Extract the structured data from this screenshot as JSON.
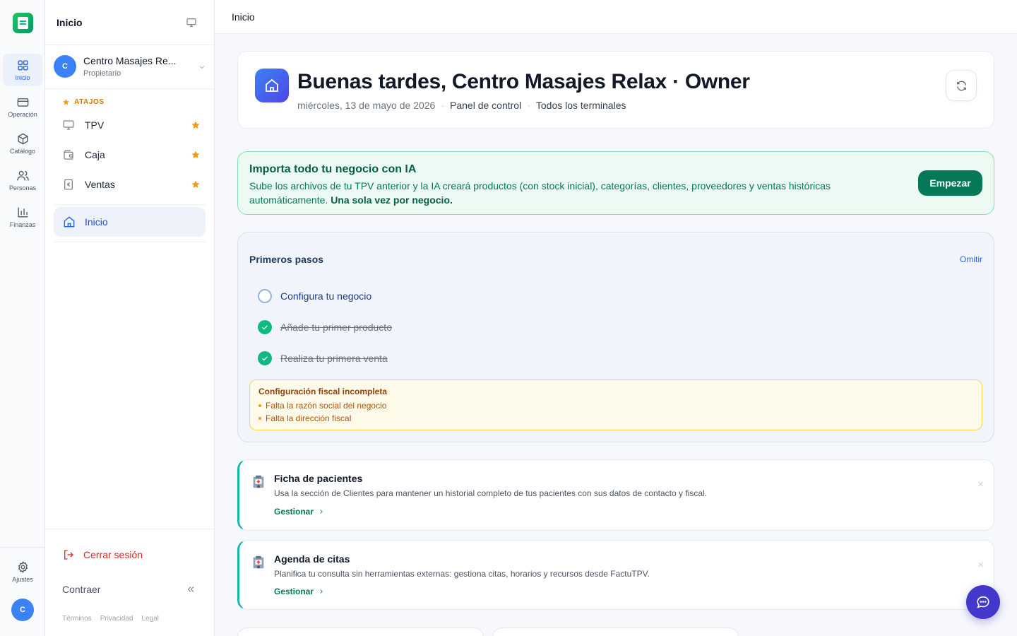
{
  "rail": {
    "items": [
      {
        "label": "Inicio",
        "icon": "grid-icon",
        "active": true
      },
      {
        "label": "Operación",
        "icon": "credit-card-icon"
      },
      {
        "label": "Catálogo",
        "icon": "box-icon"
      },
      {
        "label": "Personas",
        "icon": "users-icon"
      },
      {
        "label": "Finanzas",
        "icon": "bar-chart-icon"
      }
    ],
    "settings_label": "Ajustes",
    "avatar_initial": "C"
  },
  "sidebar": {
    "title": "Inicio",
    "business": {
      "name": "Centro Masajes Re...",
      "role": "Propietario",
      "initial": "C"
    },
    "shortcuts_label": "ATAJOS",
    "shortcuts": [
      {
        "label": "TPV",
        "icon": "monitor-icon"
      },
      {
        "label": "Caja",
        "icon": "wallet-icon"
      },
      {
        "label": "Ventas",
        "icon": "receipt-icon"
      }
    ],
    "active_nav": "Inicio",
    "logout_label": "Cerrar sesión",
    "collapse_label": "Contraer",
    "legal_links": [
      "Términos",
      "Privacidad",
      "Legal"
    ]
  },
  "topbar": {
    "breadcrumb": "Inicio"
  },
  "hero": {
    "greeting": "Buenas tardes, Centro Masajes Relax · Owner",
    "date": "miércoles, 13 de mayo de 2026",
    "panel": "Panel de control",
    "terminals": "Todos los terminales"
  },
  "ia_banner": {
    "title": "Importa todo tu negocio con IA",
    "text": "Sube los archivos de tu TPV anterior y la IA creará productos (con stock inicial), categorías, clientes, proveedores y ventas históricas automáticamente.",
    "bold": "Una sola vez por negocio.",
    "button": "Empezar"
  },
  "onboarding": {
    "title": "Primeros pasos",
    "skip_label": "Omitir",
    "steps": [
      {
        "label": "Configura tu negocio",
        "done": false
      },
      {
        "label": "Añade tu primer producto",
        "done": true
      },
      {
        "label": "Realiza tu primera venta",
        "done": true
      }
    ],
    "fiscal_warning": {
      "title": "Configuración fiscal incompleta",
      "items": [
        "Falta la razón social del negocio",
        "Falta la dirección fiscal"
      ]
    }
  },
  "tips": [
    {
      "title": "Ficha de pacientes",
      "text": "Usa la sección de Clientes para mantener un historial completo de tus pacientes con sus datos de contacto y fiscal.",
      "link": "Gestionar",
      "close": "×"
    },
    {
      "title": "Agenda de citas",
      "text": "Planifica tu consulta sin herramientas externas: gestiona citas, horarios y recursos desde FactuTPV.",
      "link": "Gestionar",
      "close": "×"
    }
  ],
  "colors": {
    "accent": "#2563eb",
    "brand_green": "#047857",
    "danger": "#dc2626",
    "warning": "#f59e0b"
  }
}
